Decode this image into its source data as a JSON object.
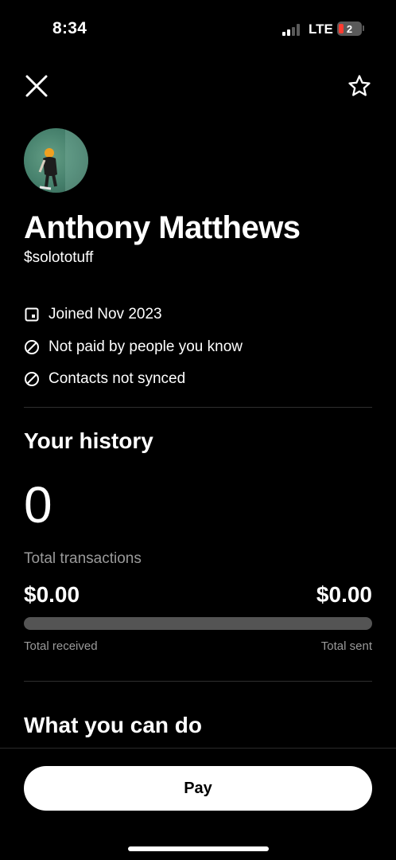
{
  "status_bar": {
    "time": "8:34",
    "network": "LTE",
    "battery_level": "2",
    "signal_bars": 2,
    "signal_max": 4,
    "icons": [
      "signal-icon",
      "battery-icon"
    ]
  },
  "header": {
    "close_icon": "close-icon",
    "favorite_icon": "star-icon"
  },
  "profile": {
    "name": "Anthony Matthews",
    "handle": "$solototuff",
    "details": [
      {
        "icon": "calendar-icon",
        "text": "Joined Nov 2023"
      },
      {
        "icon": "prohibited-icon",
        "text": "Not paid by people you know"
      },
      {
        "icon": "prohibited-icon",
        "text": "Contacts not synced"
      }
    ]
  },
  "history": {
    "title": "Your history",
    "total_count": "0",
    "total_label": "Total transactions",
    "received_amount": "$0.00",
    "sent_amount": "$0.00",
    "received_label": "Total received",
    "sent_label": "Total sent",
    "received_fraction": 0
  },
  "actions": {
    "title": "What you can do"
  },
  "footer": {
    "pay_label": "Pay"
  },
  "colors": {
    "background": "#000000",
    "text_primary": "#ffffff",
    "text_secondary": "#9a9a9a",
    "divider": "#2f2f2f",
    "bar": "#545454",
    "battery_low": "#ff3b30"
  }
}
